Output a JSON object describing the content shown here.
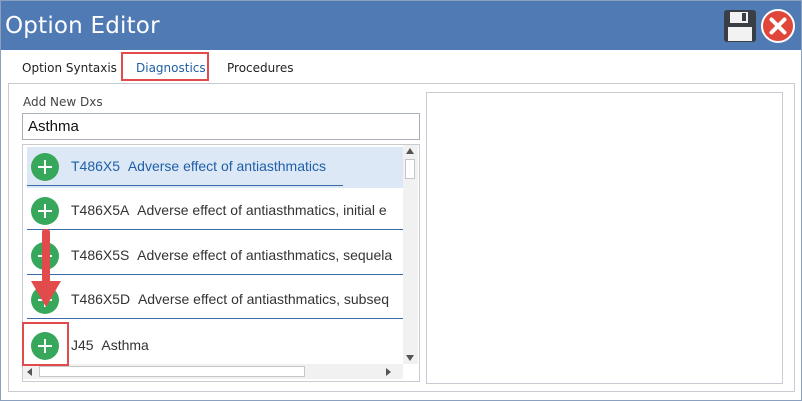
{
  "window": {
    "title": "Option Editor"
  },
  "toolbar": {
    "save_icon": "floppy-disk-icon",
    "close_icon": "close-icon"
  },
  "tabs": [
    {
      "label": "Option Syntaxis",
      "active": false
    },
    {
      "label": "Diagnostics",
      "active": true
    },
    {
      "label": "Procedures",
      "active": false
    }
  ],
  "add_dx": {
    "label": "Add New Dxs",
    "value": "Asthma"
  },
  "results": [
    {
      "code": "T486X5",
      "description": "Adverse effect of antiasthmatics",
      "selected": true
    },
    {
      "code": "T486X5A",
      "description": "Adverse effect of antiasthmatics, initial e",
      "selected": false
    },
    {
      "code": "T486X5S",
      "description": "Adverse effect of antiasthmatics, sequela",
      "selected": false
    },
    {
      "code": "T486X5D",
      "description": "Adverse effect of antiasthmatics, subseq",
      "selected": false
    },
    {
      "code": "J45",
      "description": "Asthma",
      "selected": false
    }
  ],
  "colors": {
    "titlebar": "#4f7ab3",
    "accent": "#1f5fa8",
    "add_button": "#37a85b",
    "annotation": "#e24b4b"
  }
}
